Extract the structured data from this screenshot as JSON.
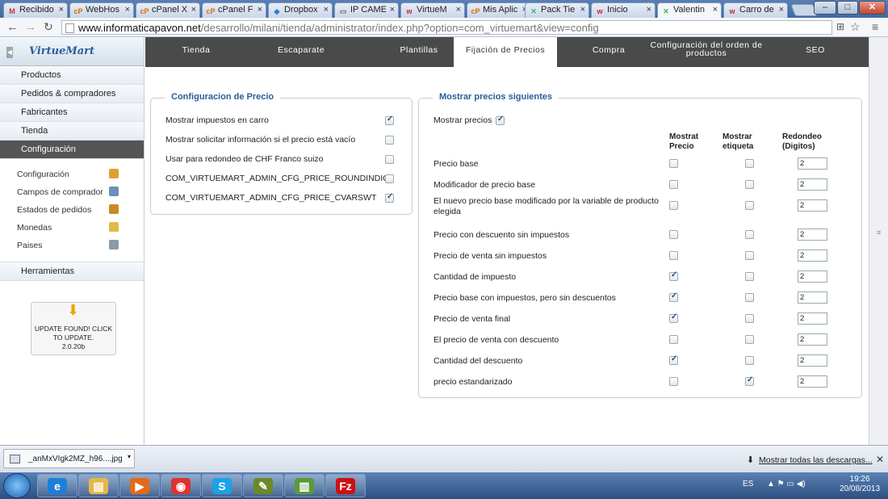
{
  "browser": {
    "tabs": [
      {
        "icon": "gmail-icon",
        "glyph": "M",
        "color": "#c33",
        "label": "Recibido"
      },
      {
        "icon": "cpanel-icon",
        "glyph": "cP",
        "color": "#e06a00",
        "label": "WebHos"
      },
      {
        "icon": "cpanel-icon",
        "glyph": "cP",
        "color": "#e06a00",
        "label": "cPanel X"
      },
      {
        "icon": "cpanel-icon",
        "glyph": "cP",
        "color": "#e06a00",
        "label": "cPanel F"
      },
      {
        "icon": "dropbox-icon",
        "glyph": "◆",
        "color": "#2a7bd6",
        "label": "Dropbox"
      },
      {
        "icon": "page-icon",
        "glyph": "▭",
        "color": "#666",
        "label": "IP CAME"
      },
      {
        "icon": "w-icon",
        "glyph": "w",
        "color": "#c23",
        "label": "VirtueM"
      },
      {
        "icon": "cpanel-icon",
        "glyph": "cP",
        "color": "#e06a00",
        "label": "Mis Aplic"
      },
      {
        "icon": "joomla-icon",
        "glyph": "✕",
        "color": "#3b6",
        "label": "Pack Tie"
      },
      {
        "icon": "w-icon",
        "glyph": "w",
        "color": "#c23",
        "label": "Inicio"
      },
      {
        "icon": "joomla-icon",
        "glyph": "✕",
        "color": "#3b6",
        "label": "Valentin"
      },
      {
        "icon": "w-icon",
        "glyph": "w",
        "color": "#c23",
        "label": "Carro de"
      }
    ],
    "url_host": "www.informaticapavon.net",
    "url_path": "/desarrollo/milani/tienda/administrator/index.php?option=com_virtuemart&view=config",
    "window_buttons": {
      "min": "–",
      "max": "□",
      "close": "✕"
    }
  },
  "sidebar": {
    "logo": "VirtueMart",
    "menu": [
      "Productos",
      "Pedidos & compradores",
      "Fabricantes",
      "Tienda",
      "Configuración"
    ],
    "submenu": [
      {
        "label": "Configuración",
        "icon": "tools-icon",
        "color": "#e0a030"
      },
      {
        "label": "Campos de comprador",
        "icon": "user-fields-icon",
        "color": "#6a8fb8"
      },
      {
        "label": "Estados de pedidos",
        "icon": "order-status-icon",
        "color": "#c98a2a"
      },
      {
        "label": "Monedas",
        "icon": "coins-icon",
        "color": "#e3b84a"
      },
      {
        "label": "Paises",
        "icon": "globe-icon",
        "color": "#8a9aa8"
      }
    ],
    "tools": "Herramientas",
    "update": {
      "line1": "UPDATE FOUND! CLICK",
      "line2": "TO UPDATE.",
      "version": "2.0.20b"
    }
  },
  "page_tabs": [
    "Tienda",
    "Escaparate",
    "Plantillas",
    "Fijación de Precios",
    "Compra",
    "Configuración del orden de productos",
    "SEO"
  ],
  "price_config": {
    "legend": "Configuracion de Precio",
    "rows": [
      {
        "label": "Mostrar impuestos en carro",
        "checked": true
      },
      {
        "label": "Mostrar solicitar información si el precio está vacío",
        "checked": false
      },
      {
        "label": "Usar para redondeo de CHF Franco suizo",
        "checked": false
      },
      {
        "label": "COM_VIRTUEMART_ADMIN_CFG_PRICE_ROUNDINDIG",
        "checked": false
      },
      {
        "label": "COM_VIRTUEMART_ADMIN_CFG_PRICE_CVARSWT",
        "checked": true
      }
    ]
  },
  "show_prices": {
    "legend": "Mostrar precios siguientes",
    "show_label": "Mostrar precios",
    "show_checked": true,
    "headers": {
      "price": "Mostrat Precio",
      "label": "Mostrar etiqueta",
      "round": "Redondeo (Digitos)"
    },
    "rows": [
      {
        "label": "Precio base",
        "price": false,
        "tag": false,
        "round": "2"
      },
      {
        "label": "Modificador de precio base",
        "price": false,
        "tag": false,
        "round": "2"
      },
      {
        "label": "El nuevo precio base modificado por la variable de producto elegida",
        "price": false,
        "tag": false,
        "round": "2"
      },
      {
        "label": "Precio con descuento sin impuestos",
        "price": false,
        "tag": false,
        "round": "2"
      },
      {
        "label": "Precio de venta sin impuestos",
        "price": false,
        "tag": false,
        "round": "2"
      },
      {
        "label": "Cantidad de impuesto",
        "price": true,
        "tag": false,
        "round": "2"
      },
      {
        "label": "Precio base con impuestos, pero sin descuentos",
        "price": true,
        "tag": false,
        "round": "2"
      },
      {
        "label": "Precio de venta final",
        "price": true,
        "tag": false,
        "round": "2"
      },
      {
        "label": "El precio de venta con descuento",
        "price": false,
        "tag": false,
        "round": "2"
      },
      {
        "label": "Cantidad del descuento",
        "price": true,
        "tag": false,
        "round": "2"
      },
      {
        "label": "precio estandarizado",
        "price": false,
        "tag": true,
        "round": "2"
      }
    ]
  },
  "downloads": {
    "file": "_anMxVIgk2MZ_h96....jpg",
    "show_all": "Mostrar todas las descargas..."
  },
  "taskbar": {
    "apps": [
      {
        "icon": "ie-icon",
        "glyph": "e",
        "color": "#1e7fd8"
      },
      {
        "icon": "explorer-icon",
        "glyph": "▤",
        "color": "#e6b84a"
      },
      {
        "icon": "media-player-icon",
        "glyph": "▶",
        "color": "#e46a1a"
      },
      {
        "icon": "chrome-icon",
        "glyph": "◉",
        "color": "#d33"
      },
      {
        "icon": "skype-icon",
        "glyph": "S",
        "color": "#1aa3e8"
      },
      {
        "icon": "paint-icon",
        "glyph": "✎",
        "color": "#6a8a2a"
      },
      {
        "icon": "chart-app-icon",
        "glyph": "▥",
        "color": "#5a9a3a"
      },
      {
        "icon": "filezilla-icon",
        "glyph": "Fz",
        "color": "#c11"
      }
    ],
    "lang": "ES",
    "time": "19:26",
    "date": "20/08/2013"
  }
}
